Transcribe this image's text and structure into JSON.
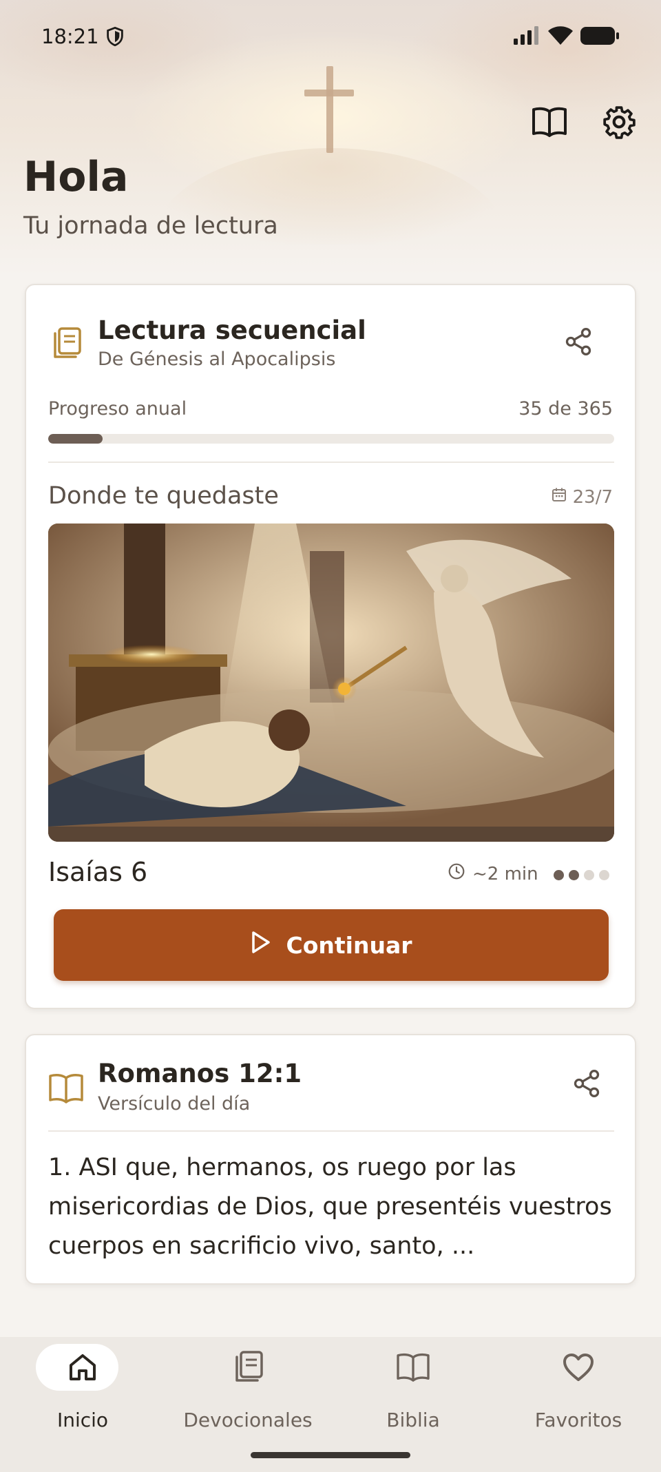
{
  "status_bar": {
    "time": "18:21"
  },
  "header": {
    "greeting": "Hola",
    "subtitle": "Tu jornada de lectura"
  },
  "reading_card": {
    "title": "Lectura secuencial",
    "subtitle": "De Génesis al Apocalipsis",
    "progress_label": "Progreso anual",
    "progress_text": "35 de 365",
    "progress_value": 35,
    "progress_max": 365,
    "resume_label": "Donde te quedaste",
    "date": "23/7",
    "chapter": "Isaías 6",
    "duration": "~2 min",
    "page_dots": {
      "total": 4,
      "filled": 2
    },
    "continue_label": "Continuar"
  },
  "verse_card": {
    "reference": "Romanos 12:1",
    "subtitle": "Versículo del día",
    "text": "1. ASI que, hermanos, os ruego por las misericordias de Dios, que presentéis vuestros cuerpos en sacrificio vivo, santo, ..."
  },
  "bottom_nav": {
    "items": [
      {
        "label": "Inicio",
        "icon": "home-icon",
        "active": true
      },
      {
        "label": "Devocionales",
        "icon": "devotionals-icon",
        "active": false
      },
      {
        "label": "Biblia",
        "icon": "book-icon",
        "active": false
      },
      {
        "label": "Favoritos",
        "icon": "heart-icon",
        "active": false
      }
    ]
  },
  "colors": {
    "accent": "#a84e1c",
    "gold_icon": "#b58a3a",
    "progress": "#6d5e55"
  }
}
